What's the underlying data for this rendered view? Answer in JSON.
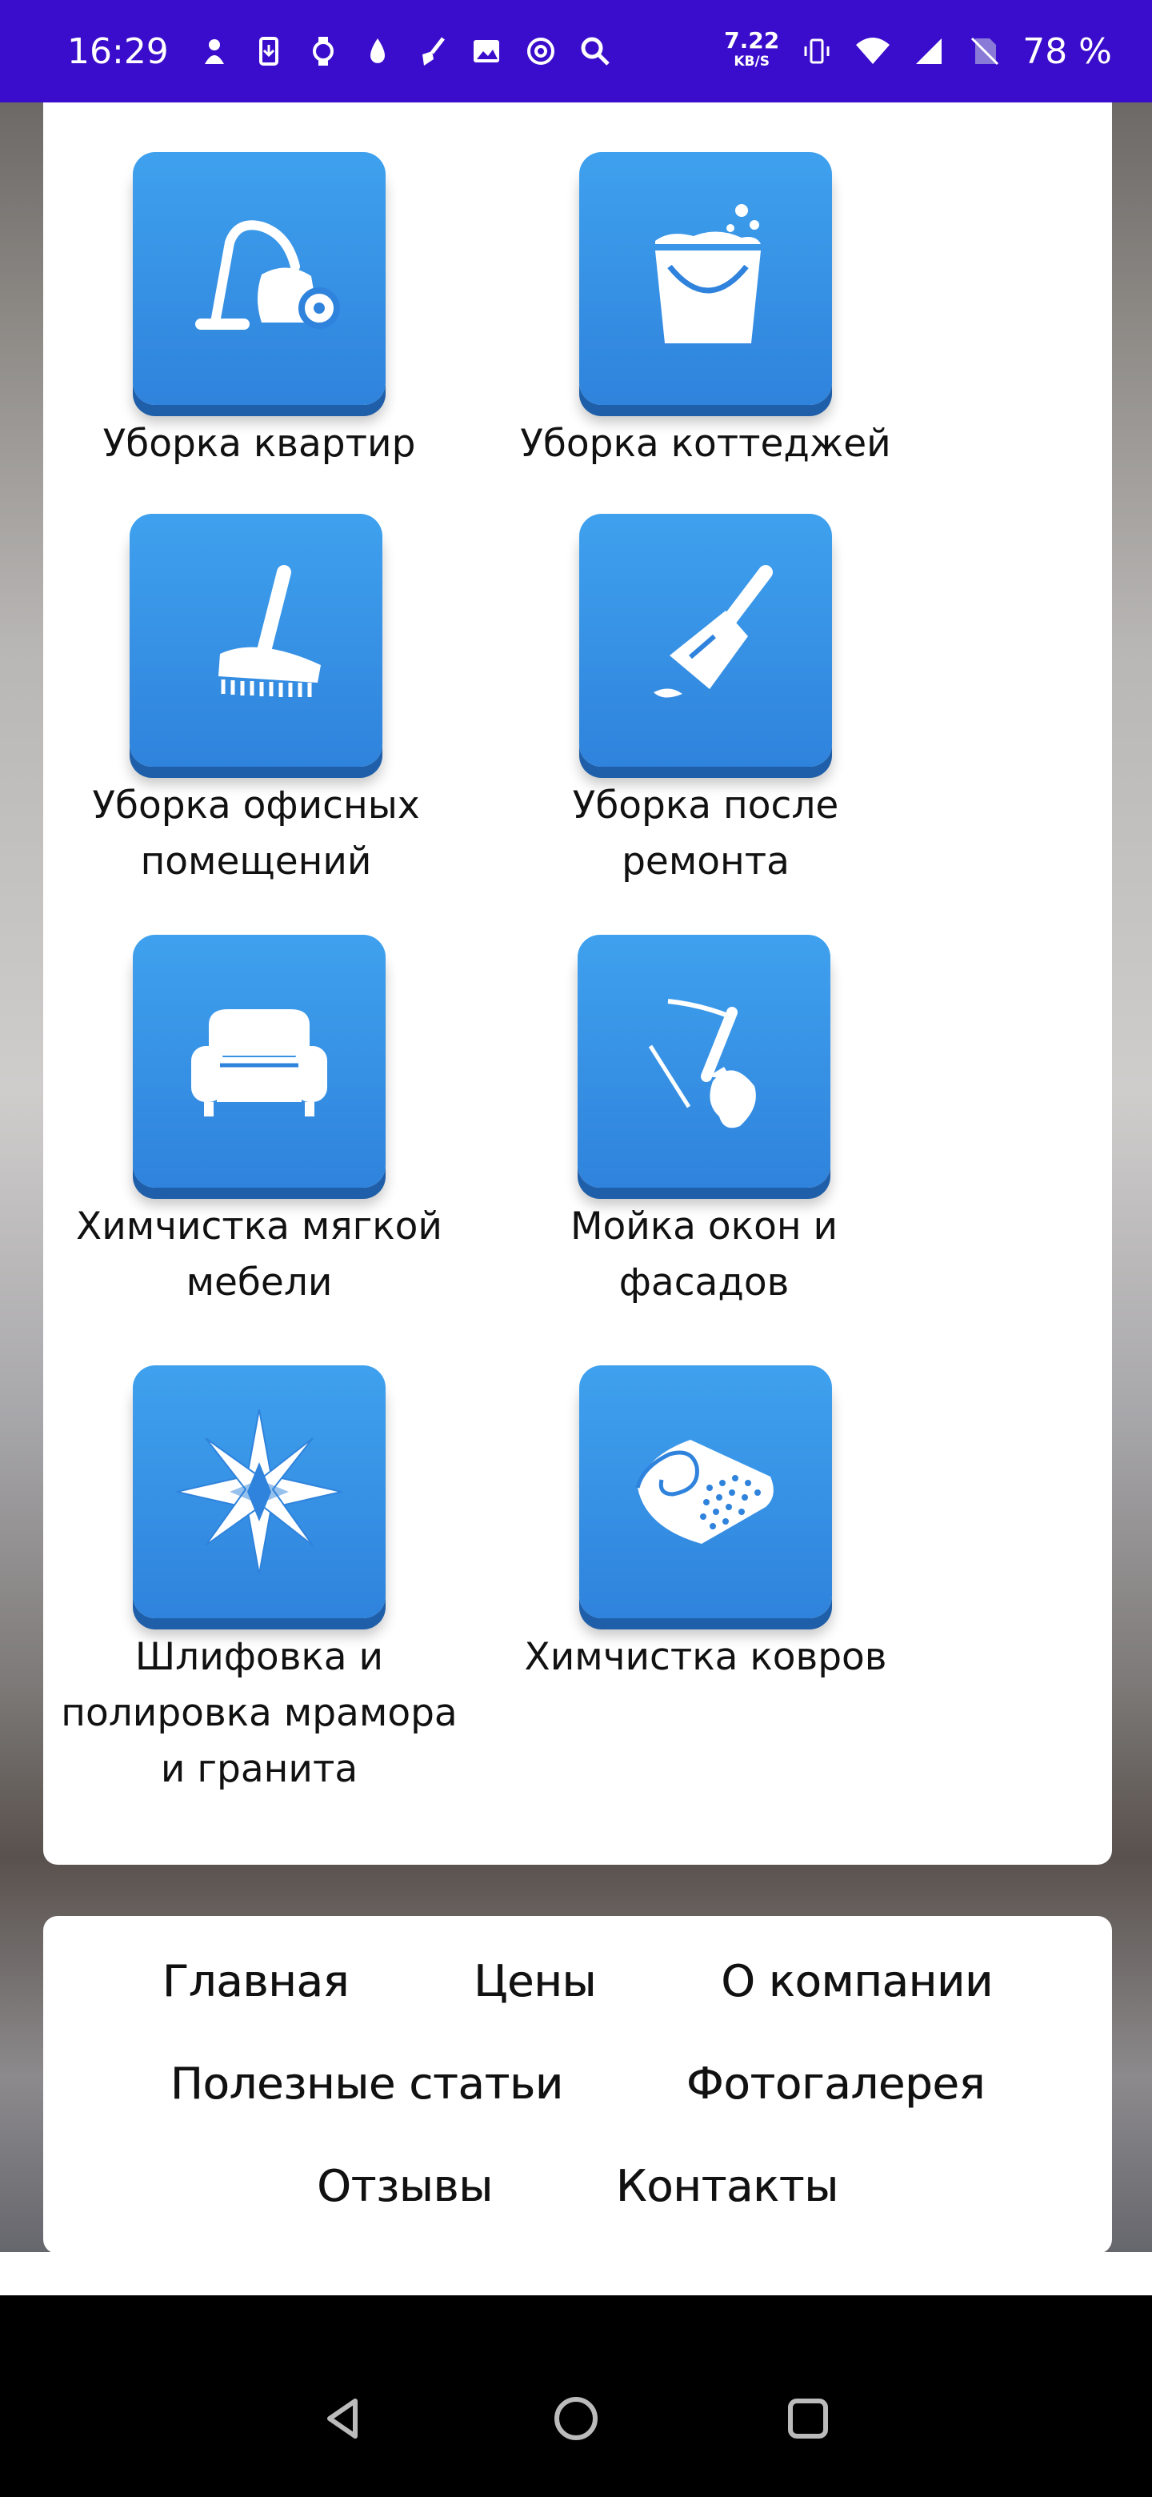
{
  "status_bar": {
    "time": "16:29",
    "speed_value": "7.22",
    "speed_unit": "KB/S",
    "battery": "78 %"
  },
  "services": [
    {
      "label": "Уборка квартир",
      "icon": "vacuum-cleaner-icon"
    },
    {
      "label": "Уборка коттеджей",
      "icon": "bucket-icon"
    },
    {
      "label": "Уборка офисных помещений",
      "icon": "floor-brush-icon"
    },
    {
      "label": "Уборка после ремонта",
      "icon": "dustpan-icon"
    },
    {
      "label": "Химчистка мягкой мебели",
      "icon": "sofa-icon"
    },
    {
      "label": "Мойка окон и фасадов",
      "icon": "window-squeegee-icon"
    },
    {
      "label": "Шлифовка и полировка мрамора и гранита",
      "icon": "compass-star-icon"
    },
    {
      "label": "Химчистка ковров",
      "icon": "carpet-roll-icon"
    }
  ],
  "nav": {
    "home": "Главная",
    "prices": "Цены",
    "about": "О компании",
    "articles": "Полезные статьи",
    "gallery": "Фотогалерея",
    "reviews": "Отзывы",
    "contacts": "Контакты"
  },
  "colors": {
    "status_bar": "#3a0ccb",
    "tile_top": "#3fa1ee",
    "tile_bottom": "#2f83dc"
  }
}
